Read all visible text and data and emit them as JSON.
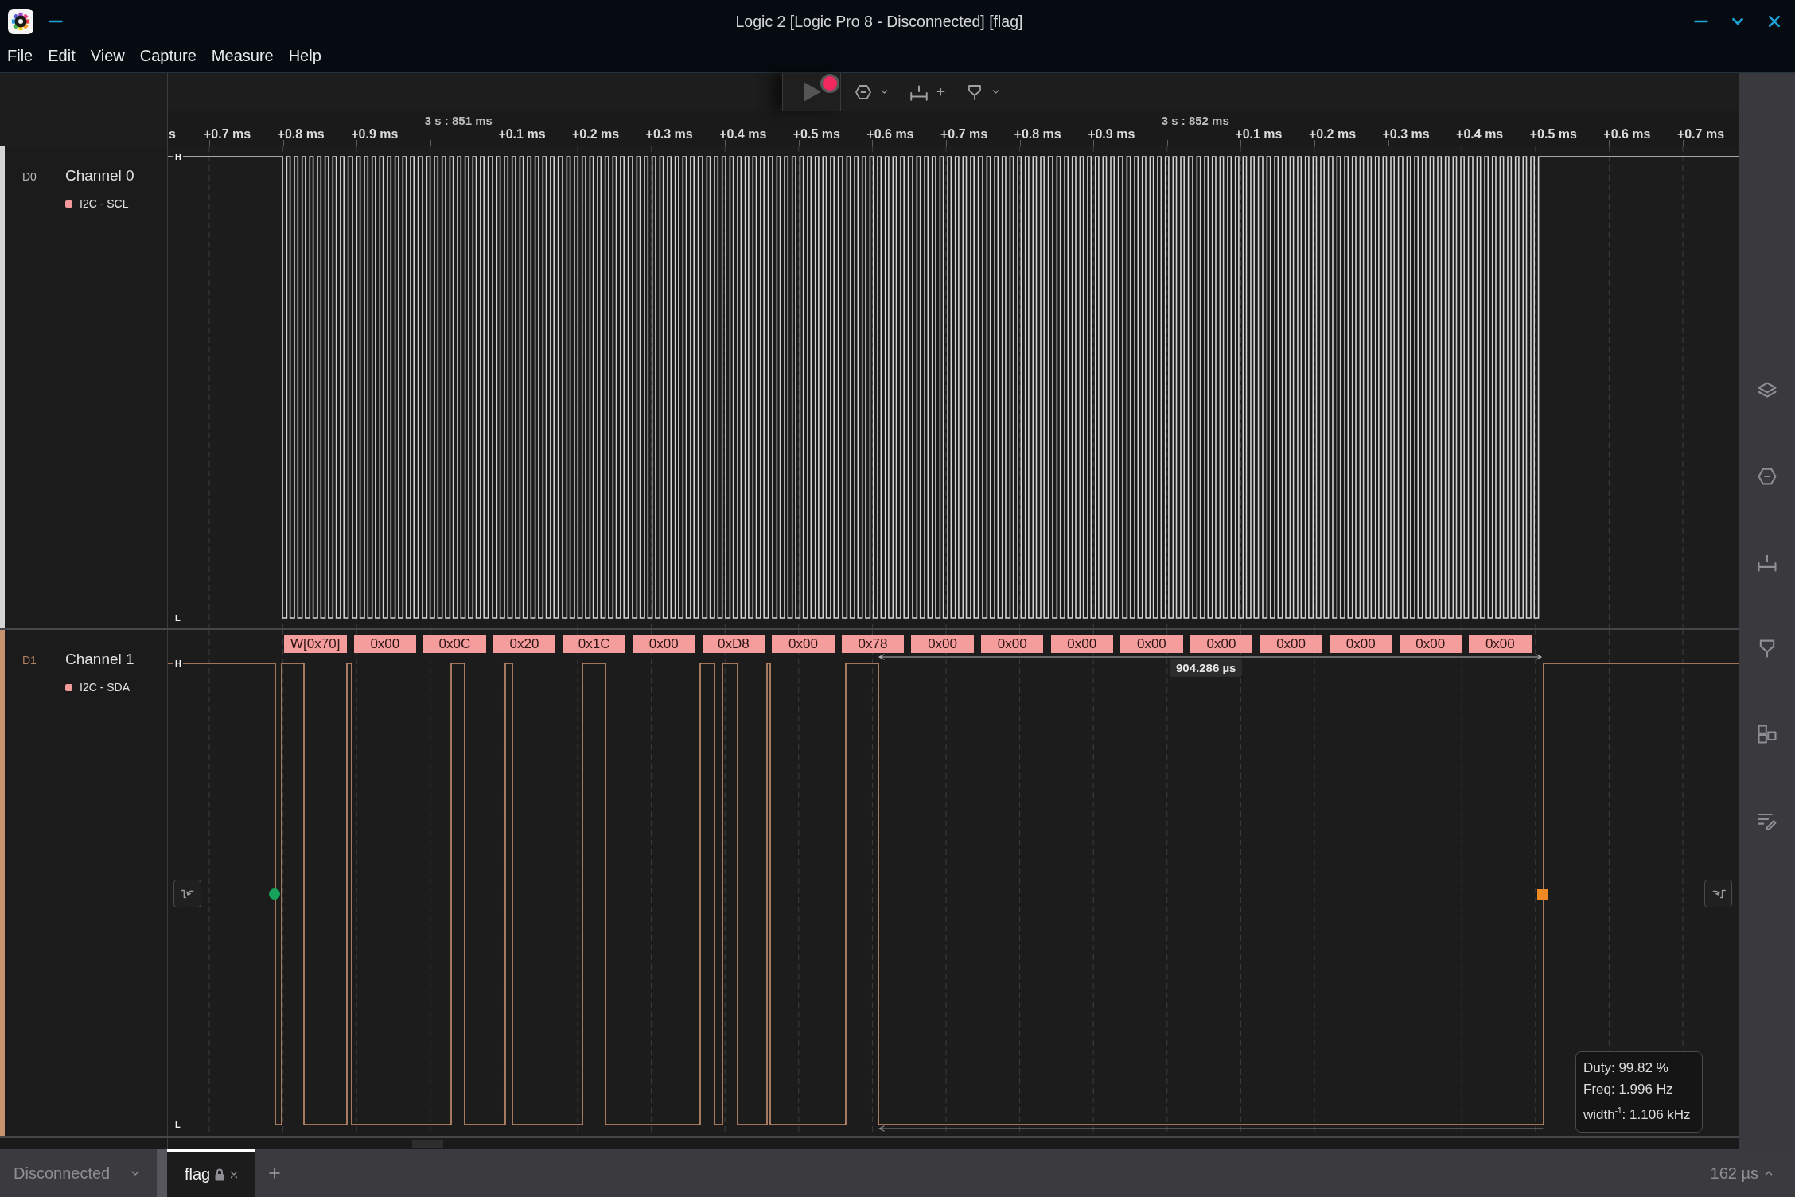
{
  "window": {
    "title": "Logic 2 [Logic Pro 8 - Disconnected] [flag]"
  },
  "menu": [
    "File",
    "Edit",
    "View",
    "Capture",
    "Measure",
    "Help"
  ],
  "time_axis": {
    "ticks": [
      {
        "kind": "partial",
        "label": "s"
      },
      {
        "kind": "minor",
        "label": "+0.7 ms"
      },
      {
        "kind": "minor",
        "label": "+0.8 ms"
      },
      {
        "kind": "minor",
        "label": "+0.9 ms"
      },
      {
        "kind": "major",
        "label": "3 s : 851 ms"
      },
      {
        "kind": "minor",
        "label": "+0.1 ms"
      },
      {
        "kind": "minor",
        "label": "+0.2 ms"
      },
      {
        "kind": "minor",
        "label": "+0.3 ms"
      },
      {
        "kind": "minor",
        "label": "+0.4 ms"
      },
      {
        "kind": "minor",
        "label": "+0.5 ms"
      },
      {
        "kind": "minor",
        "label": "+0.6 ms"
      },
      {
        "kind": "minor",
        "label": "+0.7 ms"
      },
      {
        "kind": "minor",
        "label": "+0.8 ms"
      },
      {
        "kind": "minor",
        "label": "+0.9 ms"
      },
      {
        "kind": "major",
        "label": "3 s : 852 ms"
      },
      {
        "kind": "minor",
        "label": "+0.1 ms"
      },
      {
        "kind": "minor",
        "label": "+0.2 ms"
      },
      {
        "kind": "minor",
        "label": "+0.3 ms"
      },
      {
        "kind": "minor",
        "label": "+0.4 ms"
      },
      {
        "kind": "minor",
        "label": "+0.5 ms"
      },
      {
        "kind": "minor",
        "label": "+0.6 ms"
      },
      {
        "kind": "minor",
        "label": "+0.7 ms"
      }
    ]
  },
  "channels": [
    {
      "kind": "clock",
      "id": "D0",
      "name": "Channel 0",
      "analyzer": "I2C - SCL",
      "color": "#d4d4d4",
      "high_label": "H",
      "low_label": "L"
    },
    {
      "kind": "data",
      "id": "D1",
      "name": "Channel 1",
      "analyzer": "I2C - SDA",
      "color": "#c9926f",
      "high_label": "H",
      "low_label": "L",
      "frames": [
        "W[0x70]",
        "0x00",
        "0x0C",
        "0x20",
        "0x1C",
        "0x00",
        "0xD8",
        "0x00",
        "0x78",
        "0x00",
        "0x00",
        "0x00",
        "0x00",
        "0x00",
        "0x00",
        "0x00",
        "0x00",
        "0x00"
      ]
    }
  ],
  "measurement": {
    "label": "904.286 µs"
  },
  "tooltip": {
    "lines": [
      "Duty: 99.82 %",
      "Freq: 1.996 Hz",
      "width$^{-1}$: 1.106 kHz"
    ]
  },
  "status_bar": {
    "device": "Disconnected",
    "tabs": [
      {
        "label": "flag",
        "selected": true,
        "locked": true
      }
    ],
    "zoom": "162 µs"
  }
}
